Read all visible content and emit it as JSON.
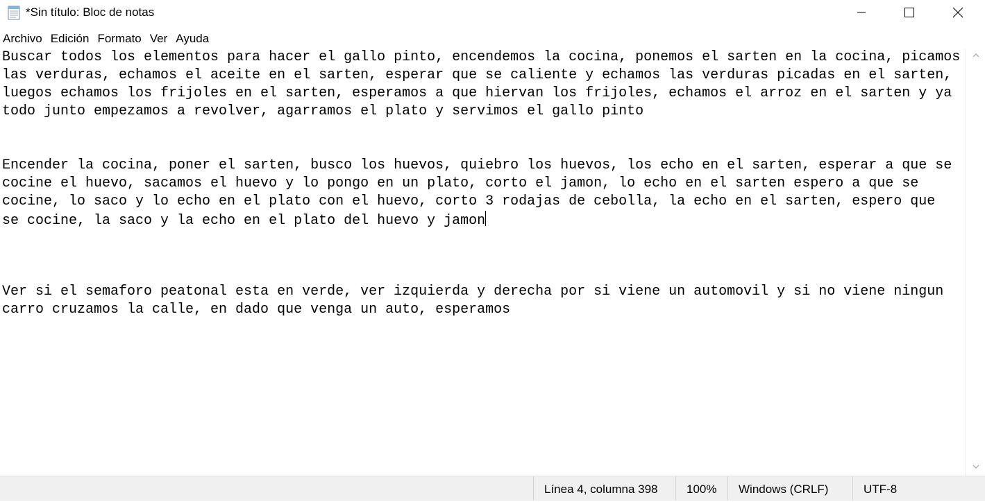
{
  "window": {
    "title": "*Sin título: Bloc de notas",
    "icon": "notepad-icon",
    "controls": {
      "minimize_icon": "minimize-icon",
      "maximize_icon": "maximize-icon",
      "close_icon": "close-icon"
    }
  },
  "menu": {
    "items": [
      {
        "label": "Archivo"
      },
      {
        "label": "Edición"
      },
      {
        "label": "Formato"
      },
      {
        "label": "Ver"
      },
      {
        "label": "Ayuda"
      }
    ]
  },
  "editor": {
    "lines": [
      "Buscar todos los elementos para hacer el gallo pinto, encendemos la cocina, ponemos el sarten en la cocina, picamos",
      "las verduras, echamos el aceite en el sarten, esperar que se caliente y echamos las verduras picadas en el sarten,",
      "luegos echamos los frijoles en el sarten, esperamos a que hiervan los frijoles, echamos el arroz en el sarten y ya",
      "todo junto empezamos a revolver, agarramos el plato y servimos el gallo pinto",
      "",
      "",
      "Encender la cocina, poner el sarten, busco los huevos, quiebro los huevos, los echo en el sarten, esperar a que se",
      "cocine el huevo, sacamos el huevo y lo pongo en un plato, corto el jamon, lo echo en el sarten espero a que se",
      "cocine, lo saco y lo echo en el plato con el huevo, corto 3 rodajas de cebolla, la echo en el sarten, espero que",
      "se cocine, la saco y la echo en el plato del huevo y jamon",
      "",
      "",
      "",
      "Ver si el semaforo peatonal esta en verde, ver izquierda y derecha por si viene un automovil y si no viene ningun",
      "carro cruzamos la calle, en dado que venga un auto, esperamos"
    ]
  },
  "status": {
    "position": "Línea 4, columna 398",
    "zoom": "100%",
    "line_ending": "Windows (CRLF)",
    "encoding": "UTF-8"
  }
}
